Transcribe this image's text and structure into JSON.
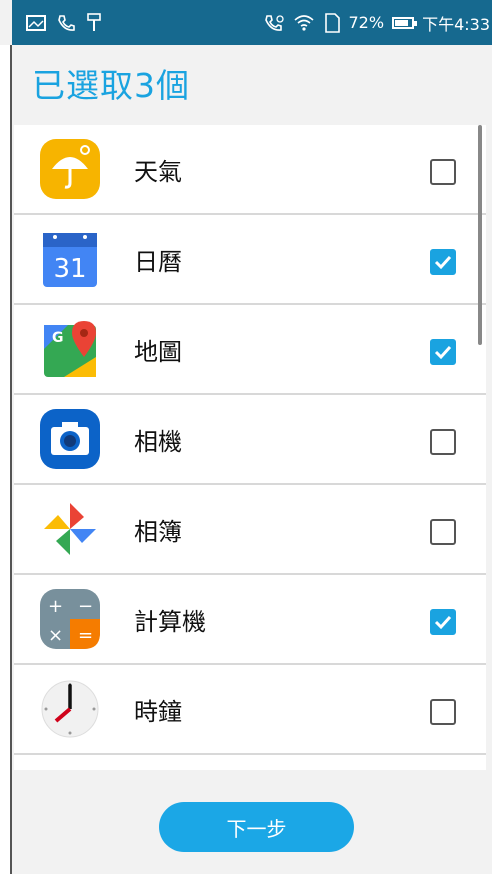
{
  "status_bar": {
    "battery": "72%",
    "time": "下午4:33",
    "icons": [
      "gallery-icon",
      "call-icon",
      "brush-icon",
      "call-icon",
      "wifi-icon",
      "sim-icon",
      "battery-icon"
    ]
  },
  "header": {
    "title": "已選取3個"
  },
  "apps": [
    {
      "name": "天氣",
      "icon": "weather-icon",
      "checked": false
    },
    {
      "name": "日曆",
      "icon": "calendar-icon",
      "checked": true,
      "icon_text": "31"
    },
    {
      "name": "地圖",
      "icon": "maps-icon",
      "checked": true
    },
    {
      "name": "相機",
      "icon": "camera-icon",
      "checked": false
    },
    {
      "name": "相簿",
      "icon": "photos-icon",
      "checked": false
    },
    {
      "name": "計算機",
      "icon": "calculator-icon",
      "checked": true
    },
    {
      "name": "時鐘",
      "icon": "clock-icon",
      "checked": false
    }
  ],
  "next_button": {
    "label": "下一步"
  },
  "colors": {
    "accent": "#1aa3e0",
    "status_bar": "#16698f"
  }
}
